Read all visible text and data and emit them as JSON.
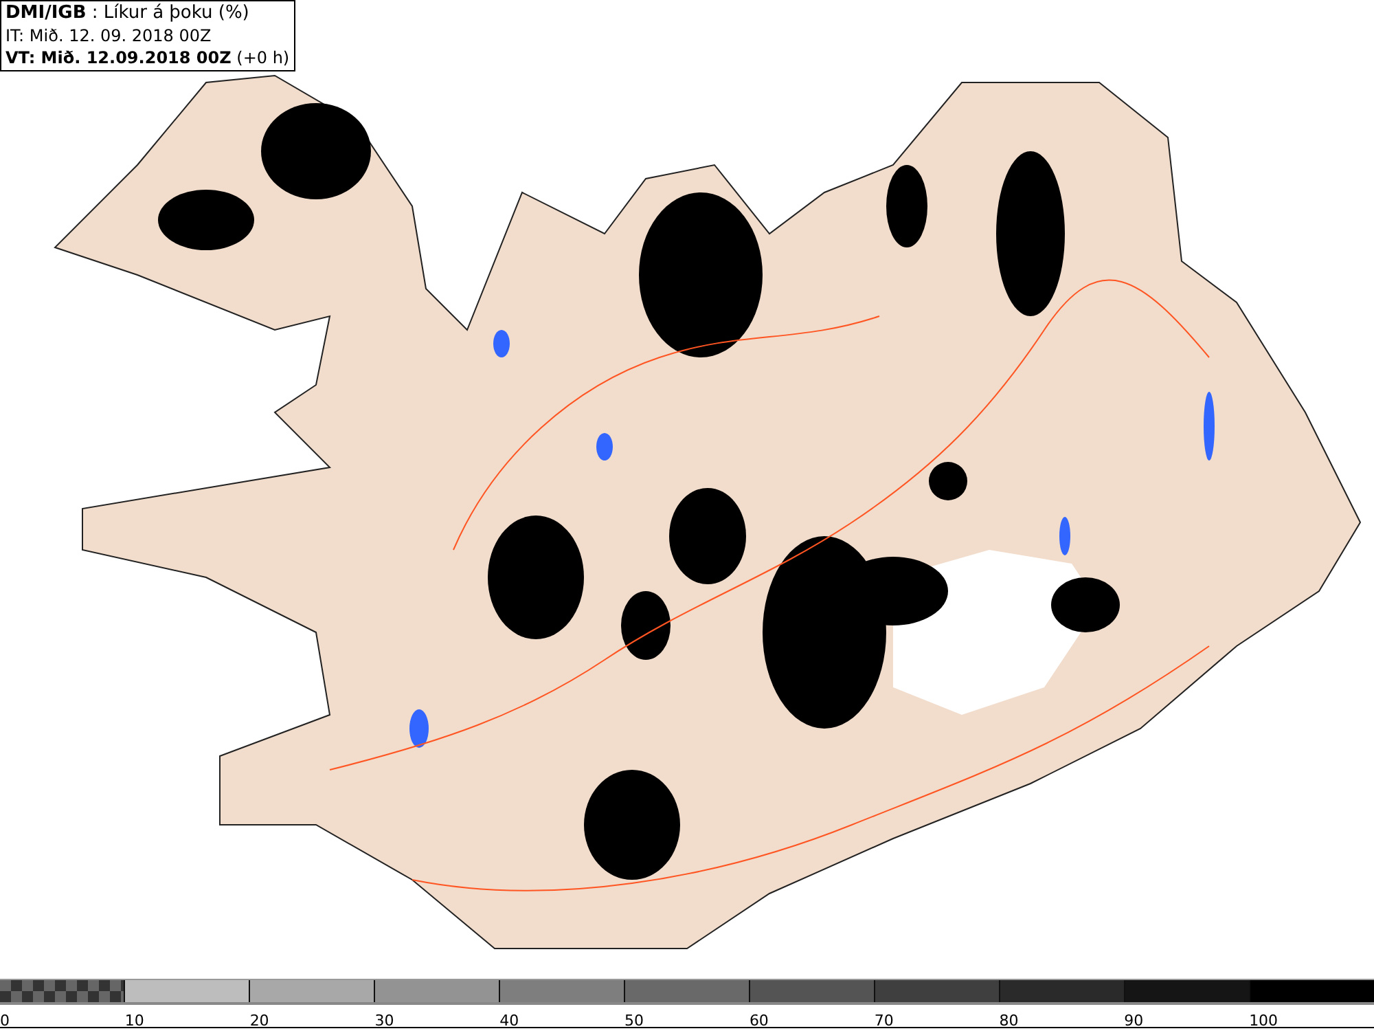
{
  "header": {
    "lines": [
      "**DMI/IGB** : Líkur á þoku (%)",
      "IT: Mið. 12. 09. 2018 00Z",
      "**VT: Mið. 12.09.2018 00Z** (+0 h)"
    ]
  },
  "legend": {
    "segments": [
      {
        "kind": "checker",
        "color": "#666666"
      },
      {
        "kind": "solid",
        "color": "#bdbdbd"
      },
      {
        "kind": "solid",
        "color": "#a8a8a8"
      },
      {
        "kind": "solid",
        "color": "#939393"
      },
      {
        "kind": "solid",
        "color": "#7e7e7e"
      },
      {
        "kind": "solid",
        "color": "#696969"
      },
      {
        "kind": "solid",
        "color": "#545454"
      },
      {
        "kind": "solid",
        "color": "#3f3f3f"
      },
      {
        "kind": "solid",
        "color": "#2a2a2a"
      },
      {
        "kind": "solid",
        "color": "#151515"
      },
      {
        "kind": "solid",
        "color": "#000000"
      }
    ],
    "labels": [
      "0",
      "10",
      "20",
      "30",
      "40",
      "50",
      "60",
      "70",
      "80",
      "90",
      "100"
    ]
  }
}
